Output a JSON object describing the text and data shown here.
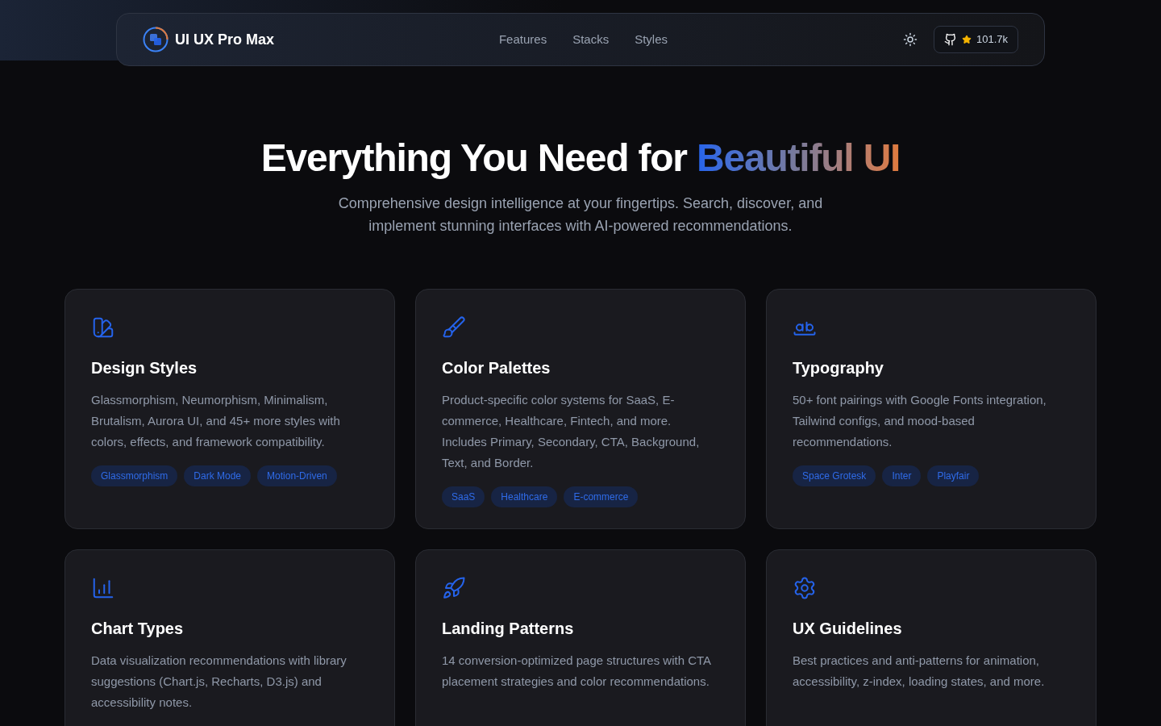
{
  "nav": {
    "brand": "UI UX Pro Max",
    "links": [
      "Features",
      "Stacks",
      "Styles"
    ],
    "stars": "101.7k"
  },
  "hero": {
    "title": "Everything You Need for ",
    "title_highlight": "Beautiful UI",
    "subtitle": "Comprehensive design intelligence at your fingertips. Search, discover, and implement stunning interfaces with AI-powered recommendations."
  },
  "cards": [
    {
      "title": "Design Styles",
      "text": "Glassmorphism, Neumorphism, Minimalism, Brutalism, Aurora UI, and 45+ more styles with colors, effects, and framework compatibility.",
      "tags": [
        "Glassmorphism",
        "Dark Mode",
        "Motion-Driven"
      ]
    },
    {
      "title": "Color Palettes",
      "text": "Product-specific color systems for SaaS, E-commerce, Healthcare, Fintech, and more. Includes Primary, Secondary, CTA, Background, Text, and Border.",
      "tags": [
        "SaaS",
        "Healthcare",
        "E-commerce"
      ]
    },
    {
      "title": "Typography",
      "text": "50+ font pairings with Google Fonts integration, Tailwind configs, and mood-based recommendations.",
      "tags": [
        "Space Grotesk",
        "Inter",
        "Playfair"
      ]
    },
    {
      "title": "Chart Types",
      "text": "Data visualization recommendations with library suggestions (Chart.js, Recharts, D3.js) and accessibility notes."
    },
    {
      "title": "Landing Patterns",
      "text": "14 conversion-optimized page structures with CTA placement strategies and color recommendations."
    },
    {
      "title": "UX Guidelines",
      "text": "Best practices and anti-patterns for animation, accessibility, z-index, loading states, and more."
    }
  ]
}
